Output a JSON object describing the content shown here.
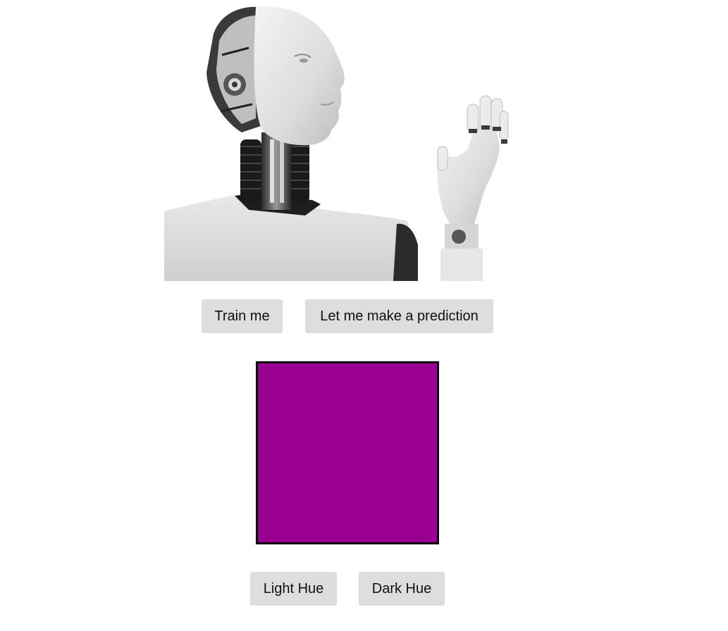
{
  "hero_image": {
    "alt": "robot-illustration"
  },
  "controls": {
    "train_label": "Train me",
    "predict_label": "Let me make a prediction"
  },
  "swatch": {
    "color": "#990091"
  },
  "answers": {
    "light_label": "Light Hue",
    "dark_label": "Dark Hue"
  }
}
